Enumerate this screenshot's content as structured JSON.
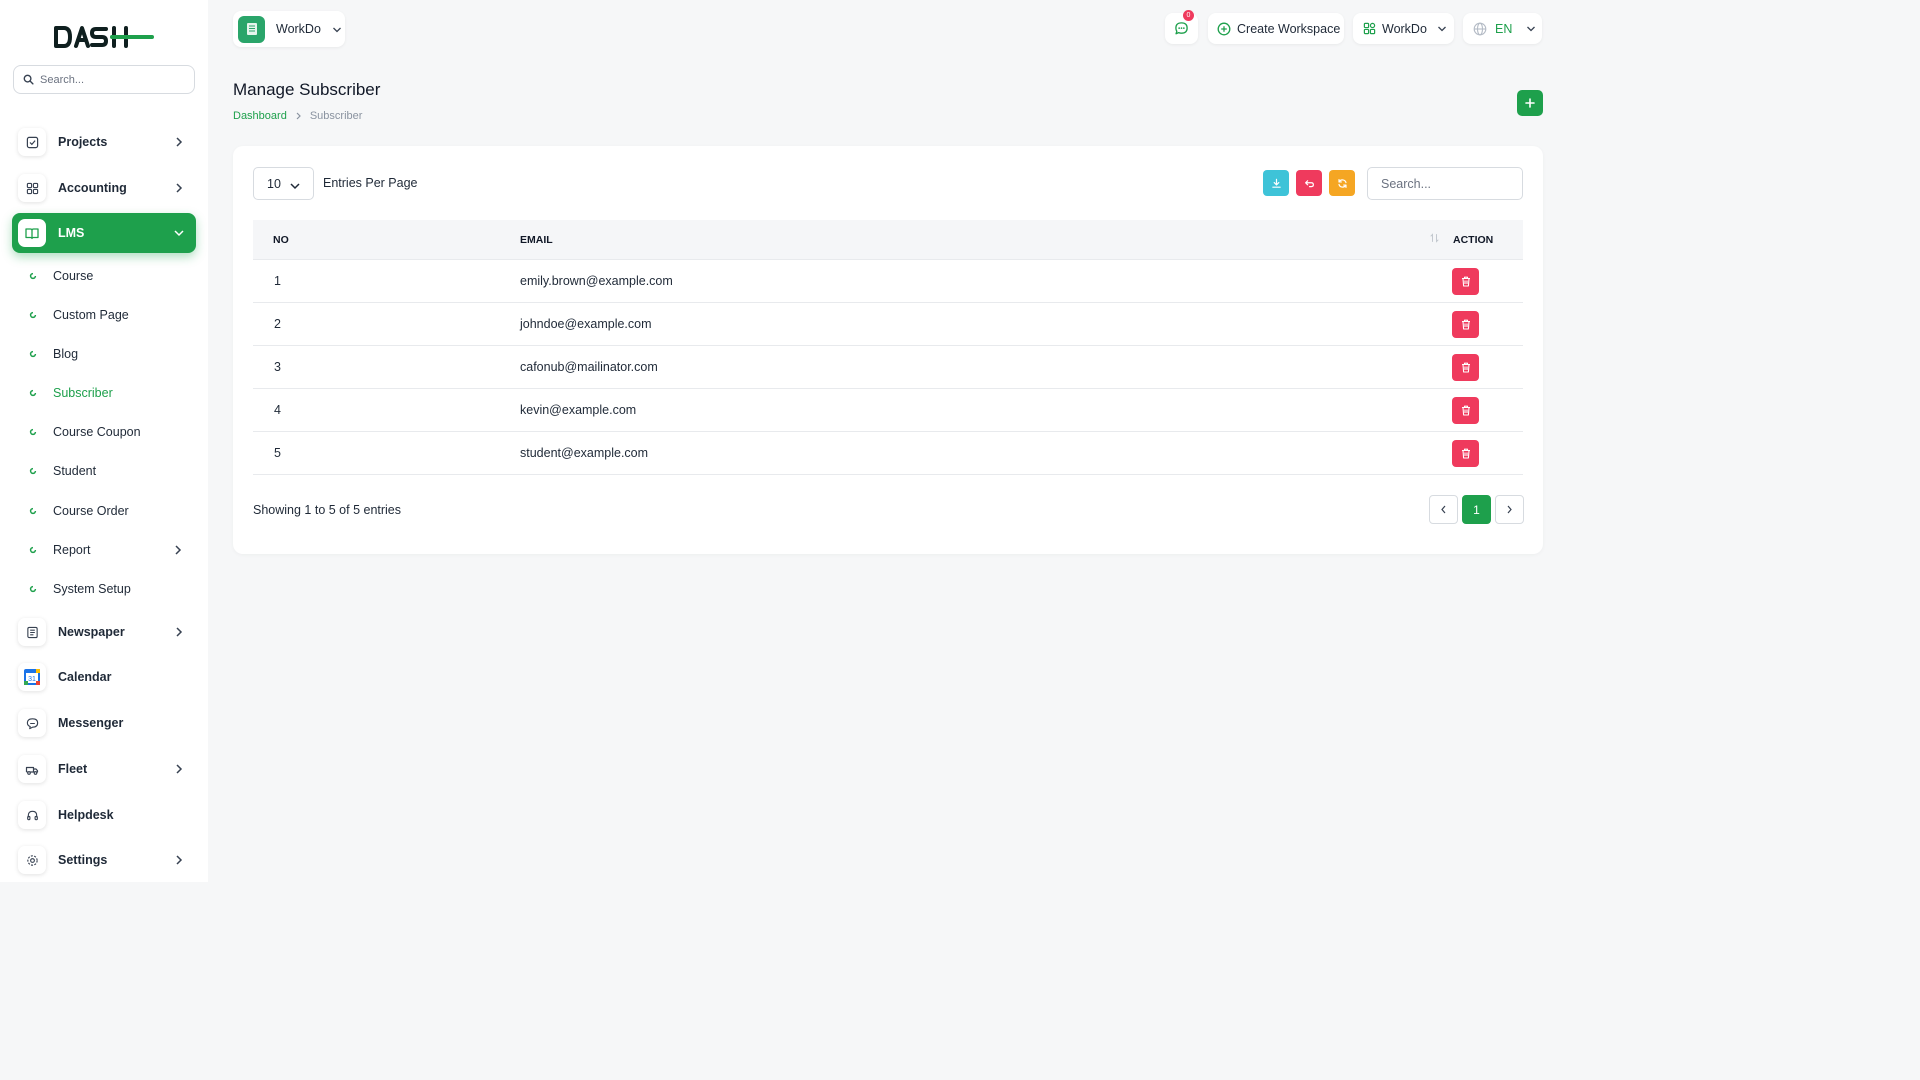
{
  "sidebar": {
    "logo_text": "DASH",
    "search_placeholder": "Search...",
    "items": [
      {
        "label": "Projects",
        "icon": "projects-icon",
        "has_chevron": true
      },
      {
        "label": "Accounting",
        "icon": "accounting-icon",
        "has_chevron": true
      },
      {
        "label": "LMS",
        "icon": "lms-book-icon",
        "has_chevron": true,
        "active": true
      },
      {
        "label": "Newspaper",
        "icon": "newspaper-icon",
        "has_chevron": true
      },
      {
        "label": "Calendar",
        "icon": "calendar-icon",
        "has_chevron": false
      },
      {
        "label": "Messenger",
        "icon": "messenger-icon",
        "has_chevron": false
      },
      {
        "label": "Fleet",
        "icon": "fleet-icon",
        "has_chevron": true
      },
      {
        "label": "Helpdesk",
        "icon": "helpdesk-icon",
        "has_chevron": false
      },
      {
        "label": "Settings",
        "icon": "settings-icon",
        "has_chevron": true
      }
    ],
    "lms_subitems": [
      {
        "label": "Course"
      },
      {
        "label": "Custom Page"
      },
      {
        "label": "Blog"
      },
      {
        "label": "Subscriber",
        "active": true
      },
      {
        "label": "Course Coupon"
      },
      {
        "label": "Student"
      },
      {
        "label": "Course Order"
      },
      {
        "label": "Report",
        "has_chevron": true
      },
      {
        "label": "System Setup"
      }
    ],
    "calendar_day": "31"
  },
  "header": {
    "workspace_name": "WorkDo",
    "messages_badge": "0",
    "create_workspace_label": "Create Workspace",
    "workspace_switch_label": "WorkDo",
    "language": "EN"
  },
  "page": {
    "title": "Manage Subscriber",
    "breadcrumb": [
      "Dashboard",
      "Subscriber"
    ]
  },
  "table_controls": {
    "per_page_value": "10",
    "per_page_label": "Entries Per Page",
    "search_placeholder": "Search..."
  },
  "table": {
    "headers": [
      "NO",
      "EMAIL",
      "ACTION"
    ],
    "rows": [
      {
        "no": "1",
        "email": "emily.brown@example.com"
      },
      {
        "no": "2",
        "email": "johndoe@example.com"
      },
      {
        "no": "3",
        "email": "cafonub@mailinator.com"
      },
      {
        "no": "4",
        "email": "kevin@example.com"
      },
      {
        "no": "5",
        "email": "student@example.com"
      }
    ]
  },
  "footer": {
    "showing_text": "Showing 1 to 5 of 5 entries",
    "current_page": "1"
  },
  "colors": {
    "brand_green": "#1ea04c",
    "danger": "#ef3a5d",
    "info": "#3ec3d8",
    "warning": "#f5a623"
  }
}
